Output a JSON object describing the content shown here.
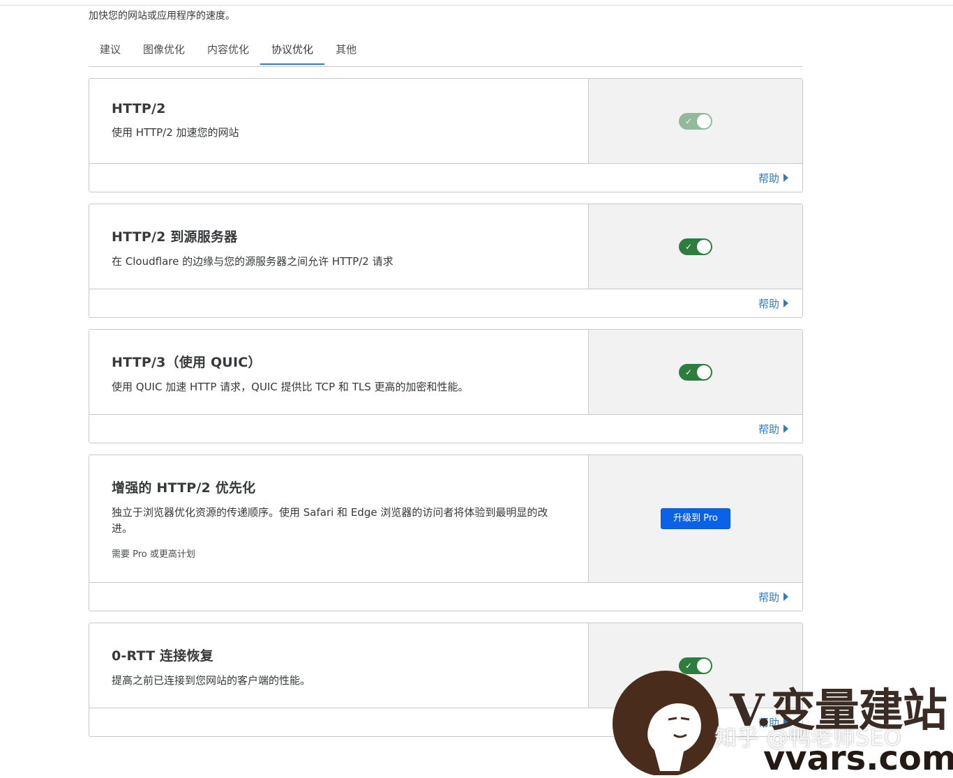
{
  "intro_text": "加快您的网站或应用程序的速度。",
  "tabs": [
    {
      "label": "建议",
      "active": false
    },
    {
      "label": "图像优化",
      "active": false
    },
    {
      "label": "内容优化",
      "active": false
    },
    {
      "label": "协议优化",
      "active": true
    },
    {
      "label": "其他",
      "active": false
    }
  ],
  "help_label": "帮助",
  "cards": [
    {
      "title": "HTTP/2",
      "description": "使用 HTTP/2 加速您的网站",
      "control": "toggle",
      "state": "on-disabled"
    },
    {
      "title": "HTTP/2 到源服务器",
      "description": "在 Cloudflare 的边缘与您的源服务器之间允许 HTTP/2 请求",
      "control": "toggle",
      "state": "on"
    },
    {
      "title": "HTTP/3（使用 QUIC）",
      "description": "使用 QUIC 加速 HTTP 请求，QUIC 提供比 TCP 和 TLS 更高的加密和性能。",
      "control": "toggle",
      "state": "on"
    },
    {
      "title": "增强的 HTTP/2 优先化",
      "description": "独立于浏览器优化资源的传递顺序。使用 Safari 和 Edge 浏览器的访问者将体验到最明显的改进。",
      "note": "需要 Pro 或更高计划",
      "control": "button",
      "button_label": "升级到 Pro"
    },
    {
      "title": "0-RTT 连接恢复",
      "description": "提高之前已连接到您网站的客户端的性能。",
      "control": "toggle",
      "state": "on"
    }
  ],
  "toggle_check_glyph": "✓",
  "colors": {
    "toggle_on": "#2e7d3f",
    "toggle_disabled": "#94b89c",
    "link": "#2f7bbf",
    "button": "#0b61e8"
  },
  "watermark": {
    "zhihu": "知乎 @鸭老师SEO",
    "brand": "V.变量建站",
    "url": "vvars.com"
  }
}
